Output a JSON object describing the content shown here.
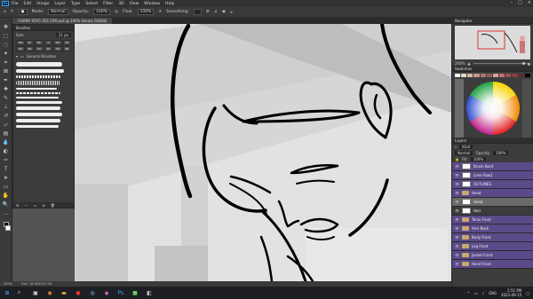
{
  "menubar": {
    "logo": "Ps",
    "items": [
      "File",
      "Edit",
      "Image",
      "Layer",
      "Type",
      "Select",
      "Filter",
      "3D",
      "View",
      "Window",
      "Help"
    ]
  },
  "options": {
    "mode_label": "Mode:",
    "mode_value": "Normal",
    "opacity_label": "Opacity:",
    "opacity_value": "100%",
    "flow_label": "Flow:",
    "flow_value": "100%",
    "smoothing_label": "Smoothing:"
  },
  "document_tab": "CHARK YOYO 1ES CAR.psd @ 200% (Head, RGB/8)",
  "brushes_panel": {
    "title": "Brushes",
    "size_label": "Size:",
    "size_value": "11 px",
    "thumb_numbers": [
      "36",
      "8",
      "21",
      "1",
      "25",
      "12",
      "20",
      "25",
      "10",
      "15",
      "19",
      "30"
    ],
    "group_label": "General Brushes"
  },
  "status_bar": {
    "zoom": "200%",
    "doc": "Doc: 18.6M/230.1M"
  },
  "navigator": {
    "title": "Navigator",
    "zoom": "200%"
  },
  "swatches": {
    "title": "Swatches"
  },
  "layers_panel": {
    "title": "Layers",
    "kind": "Kind",
    "blend": "Normal",
    "opacity_label": "Opacity:",
    "opacity_value": "100%",
    "fill_label": "Fill:",
    "fill_value": "100%",
    "layers": [
      {
        "name": "Brush Bord",
        "type": "layer",
        "color": "purple"
      },
      {
        "name": "Lime Row1",
        "type": "layer",
        "color": "purple"
      },
      {
        "name": "OUTLINES",
        "type": "layer",
        "color": "purple"
      },
      {
        "name": "Head",
        "type": "folder",
        "color": "purple"
      },
      {
        "name": "Head",
        "type": "layer",
        "color": "selected"
      },
      {
        "name": "Hair",
        "type": "layer",
        "color": "none"
      },
      {
        "name": "Torso Front",
        "type": "folder",
        "color": "purple"
      },
      {
        "name": "Arm Back",
        "type": "folder",
        "color": "purple"
      },
      {
        "name": "Body Front",
        "type": "folder",
        "color": "purple"
      },
      {
        "name": "Leg Front",
        "type": "folder",
        "color": "purple"
      },
      {
        "name": "Jacket Front",
        "type": "folder",
        "color": "purple"
      },
      {
        "name": "Hand Front",
        "type": "folder",
        "color": "purple"
      }
    ]
  },
  "taskbar": {
    "time": "2:51 PM",
    "date": "2022-09-15",
    "lang": "ENG"
  },
  "colors": {
    "ps_blue": "#31a8ff",
    "layer_purple": "#5b4a8a"
  }
}
